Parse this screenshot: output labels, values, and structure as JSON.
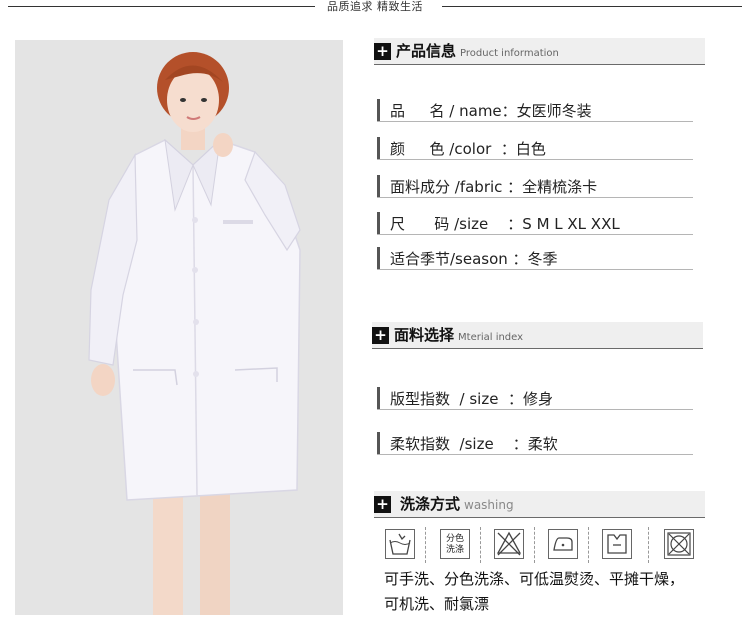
{
  "banner": {
    "text": "品质追求 精致生活"
  },
  "sections": {
    "product": {
      "title": "产品信息",
      "subtitle": "Product information"
    },
    "material": {
      "title": "面料选择",
      "subtitle": "Mterial index"
    },
    "washing": {
      "title": "洗涤方式",
      "subtitle": "washing"
    }
  },
  "product_rows": [
    "品　  名 / name：女医师冬装",
    "颜　  色 /color  ：白色",
    "面料成分 /fabric ：全精梳涤卡",
    "尺　   码 /size    ：S M L XL XXL",
    "适合季节/season ：冬季"
  ],
  "material_rows": [
    "版型指数  / size  ：修身",
    "柔软指数  /size    ：柔软"
  ],
  "washing": {
    "icons": [
      "hand-wash",
      "separate-color-wash",
      "no-bleach",
      "low-temp-iron",
      "flat-dry",
      "no-tumble-dry"
    ],
    "separate_icon_label_1": "分色",
    "separate_icon_label_2": "洗涤",
    "line1": "可手洗、分色洗涤、可低温熨烫、平摊干燥，",
    "line2": "可机洗、耐氯漂"
  },
  "colors": {
    "header_bg": "#efefef",
    "accent": "#111111",
    "coat": "#ffffff",
    "background": "#e4e4e4"
  }
}
